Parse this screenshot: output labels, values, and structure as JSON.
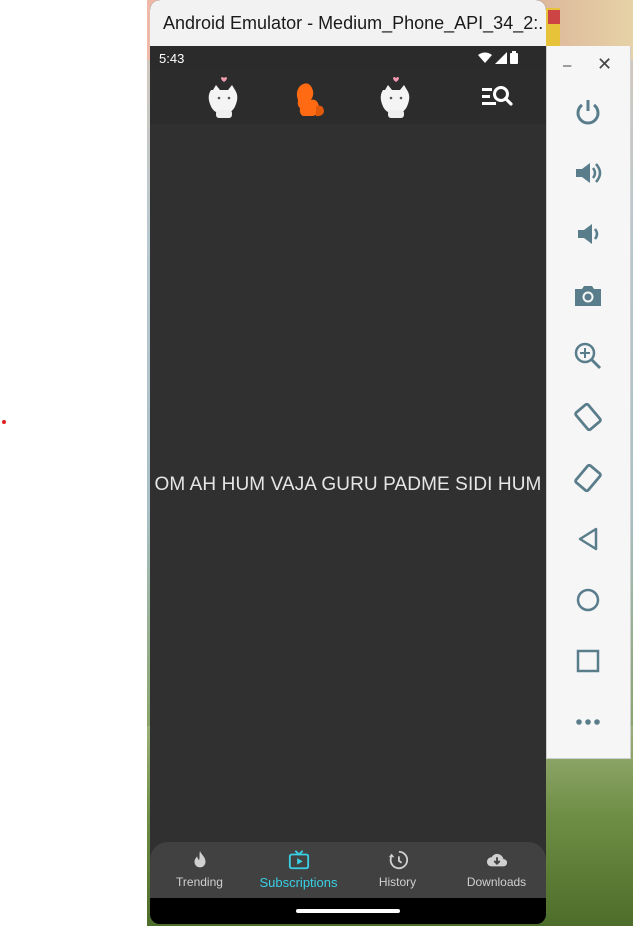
{
  "window": {
    "title": "Android Emulator - Medium_Phone_API_34_2:..."
  },
  "status_bar": {
    "time": "5:43",
    "icons": [
      "wifi-icon",
      "signal-icon",
      "battery-icon"
    ]
  },
  "app_bar": {
    "icons": [
      "cat-avatar-icon",
      "orange-squirrel-icon",
      "cat-avatar-icon",
      "search-menu-icon"
    ]
  },
  "content": {
    "text": "OM AH HUM VAJA GURU PADME SIDI HUM"
  },
  "bottom_nav": {
    "items": [
      {
        "label": "Trending",
        "icon": "flame-icon",
        "active": false
      },
      {
        "label": "Subscriptions",
        "icon": "tv-play-icon",
        "active": true
      },
      {
        "label": "History",
        "icon": "history-icon",
        "active": false
      },
      {
        "label": "Downloads",
        "icon": "cloud-download-icon",
        "active": false
      }
    ]
  },
  "toolbar": {
    "minimize": "–",
    "close": "✕",
    "buttons": [
      "power-icon",
      "volume-up-icon",
      "volume-down-icon",
      "camera-icon",
      "zoom-icon",
      "rotate-left-icon",
      "rotate-right-icon",
      "back-icon",
      "home-icon",
      "overview-icon",
      "more-icon"
    ]
  },
  "colors": {
    "accent": "#39d0e6",
    "background": "#303030",
    "nav_background": "#414141"
  }
}
